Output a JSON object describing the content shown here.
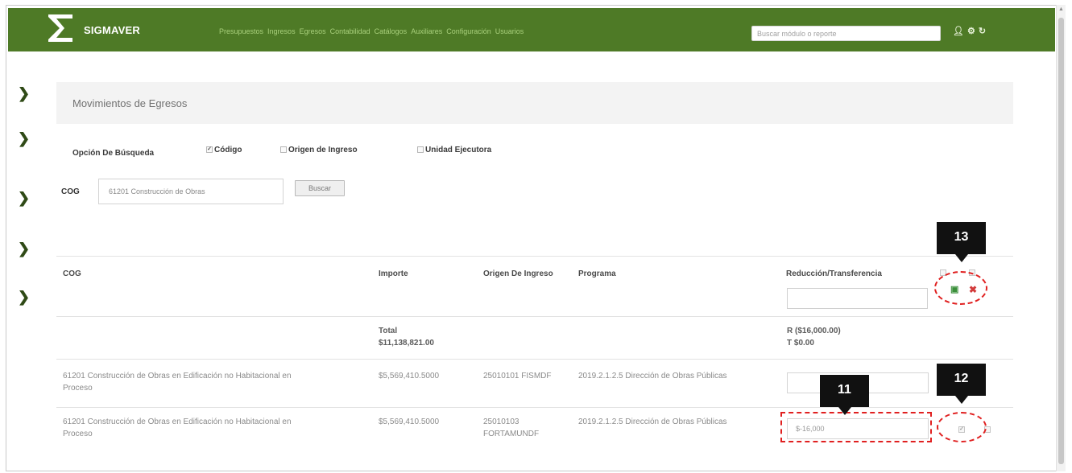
{
  "navbar": {
    "brand": "SIGMAVER",
    "menu": [
      "Presupuestos",
      "Ingresos",
      "Egresos",
      "Contabilidad",
      "Catálogos",
      "Auxiliares",
      "Configuración",
      "Usuarios"
    ],
    "search_placeholder": "Buscar módulo o reporte",
    "icons": [
      "user-icon",
      "settings-icon",
      "logout-icon"
    ],
    "color": "#4e7a26"
  },
  "page": {
    "title": "Movimientos de Egresos"
  },
  "search_options": {
    "label": "Opción De Búsqueda",
    "options": [
      {
        "label": "Código",
        "checked": true
      },
      {
        "label": "Origen de Ingreso",
        "checked": false
      },
      {
        "label": "Unidad Ejecutora",
        "checked": false
      }
    ],
    "cog_label": "COG",
    "cog_value": "61201 Construcción de Obras",
    "search_button": "Buscar"
  },
  "table": {
    "headers": [
      "COG",
      "Importe",
      "Origen De Ingreso",
      "Programa",
      "Reducción/Transferencia"
    ],
    "totals": {
      "label": "Total",
      "importe": "$11,138,821.00",
      "reduccion": "R ($16,000.00)",
      "transferencia": "T $0.00"
    },
    "rows": [
      {
        "cog": "61201 Construcción de Obras en Edificación no Habitacional en Proceso",
        "importe": "$5,569,410.5000",
        "origen": "25010101 FISMDF",
        "programa": "2019.2.1.2.5 Dirección de Obras Públicas",
        "reduccion": ""
      },
      {
        "cog": "61201 Construcción de Obras en Edificación no Habitacional en Proceso",
        "importe": "$5,569,410.5000",
        "origen": "25010103 FORTAMUNDF",
        "programa": "2019.2.1.2.5 Dirección de Obras Públicas",
        "reduccion": "$-16,000"
      }
    ]
  },
  "callouts": [
    "13",
    "11",
    "12"
  ]
}
